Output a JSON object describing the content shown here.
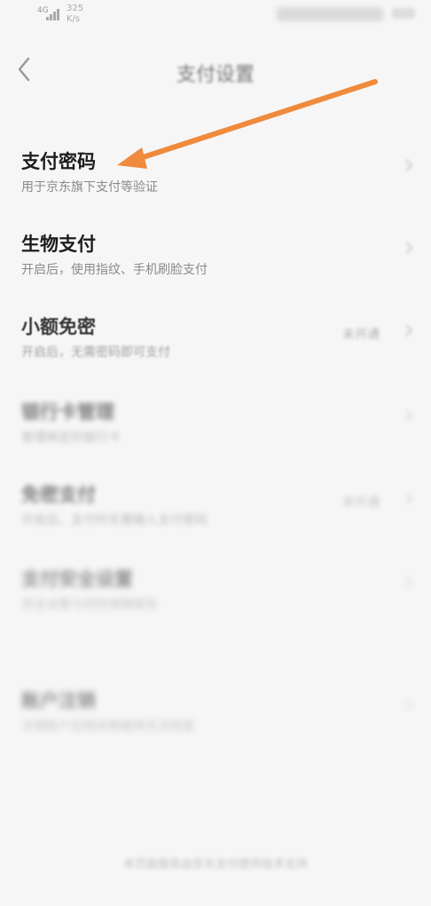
{
  "status_bar": {
    "signal": "4G",
    "speed_value": "325",
    "speed_unit": "K/s"
  },
  "header": {
    "title": "支付设置"
  },
  "settings": [
    {
      "title": "支付密码",
      "subtitle": "用于京东旗下支付等验证",
      "status": ""
    },
    {
      "title": "生物支付",
      "subtitle": "开启后，使用指纹、手机刷脸支付",
      "status": ""
    },
    {
      "title": "小额免密",
      "subtitle": "开启后，无需密码即可支付",
      "status": "未开通"
    },
    {
      "title": "银行卡管理",
      "subtitle": "管理绑定的银行卡",
      "status": ""
    },
    {
      "title": "免密支付",
      "subtitle": "开启后，支付时无需输入支付密码",
      "status": "未开通"
    },
    {
      "title": "支付安全设置",
      "subtitle": "安全设置与风险保障服务",
      "status": ""
    },
    {
      "title": "账户注销",
      "subtitle": "注销账户后相关数据将无法恢复",
      "status": ""
    }
  ],
  "footer": {
    "text": "本页面服务由京东支付提供技术支持"
  },
  "annotation": {
    "arrow_color": "#f08a3c"
  }
}
